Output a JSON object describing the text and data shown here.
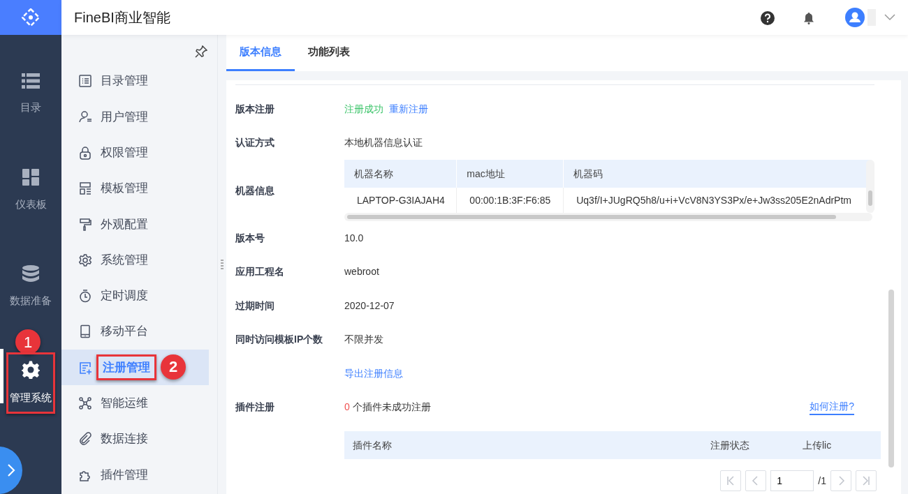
{
  "app": {
    "title": "FineBI商业智能"
  },
  "rail": {
    "items": [
      {
        "label": "目录",
        "selected": false
      },
      {
        "label": "仪表板",
        "selected": false
      },
      {
        "label": "数据准备",
        "selected": false
      },
      {
        "label": "管理系统",
        "selected": true,
        "callout": "1"
      }
    ]
  },
  "menu": {
    "items": [
      {
        "label": "目录管理",
        "selected": false
      },
      {
        "label": "用户管理",
        "selected": false
      },
      {
        "label": "权限管理",
        "selected": false
      },
      {
        "label": "模板管理",
        "selected": false
      },
      {
        "label": "外观配置",
        "selected": false
      },
      {
        "label": "系统管理",
        "selected": false
      },
      {
        "label": "定时调度",
        "selected": false
      },
      {
        "label": "移动平台",
        "selected": false
      },
      {
        "label": "注册管理",
        "selected": true,
        "callout": "2"
      },
      {
        "label": "智能运维",
        "selected": false
      },
      {
        "label": "数据连接",
        "selected": false
      },
      {
        "label": "插件管理",
        "selected": false
      }
    ]
  },
  "tabs": [
    {
      "label": "版本信息",
      "selected": true
    },
    {
      "label": "功能列表",
      "selected": false
    }
  ],
  "details": [
    {
      "kind": "status",
      "label": "版本注册",
      "status": "注册成功",
      "link": "重新注册"
    },
    {
      "kind": "text",
      "label": "认证方式",
      "value": "本地机器信息认证"
    },
    {
      "kind": "table",
      "label": "机器信息",
      "columns": [
        "机器名称",
        "mac地址",
        "机器码"
      ],
      "rows": [
        [
          "LAPTOP-G3IAJAH4",
          "00:00:1B:3F:F6:85",
          "Uq3f/I+JUgRQ5h8/u+i+VcV8N3YS3Px/e+Jw3ss205E2nAdrPtm"
        ]
      ]
    },
    {
      "kind": "text",
      "label": "版本号",
      "value": "10.0"
    },
    {
      "kind": "text",
      "label": "应用工程名",
      "value": "webroot"
    },
    {
      "kind": "text",
      "label": "过期时间",
      "value": "2020-12-07"
    },
    {
      "kind": "text",
      "label": "同时访问模板IP个数",
      "value": "不限并发"
    },
    {
      "kind": "link",
      "value": "导出注册信息"
    },
    {
      "kind": "plugins",
      "label": "插件注册",
      "count": "0",
      "text": "个插件未成功注册",
      "help": "如何注册?",
      "columns": [
        "插件名称",
        "注册状态",
        "上传lic"
      ]
    }
  ],
  "pagination": {
    "page": "1",
    "total": "/1"
  }
}
